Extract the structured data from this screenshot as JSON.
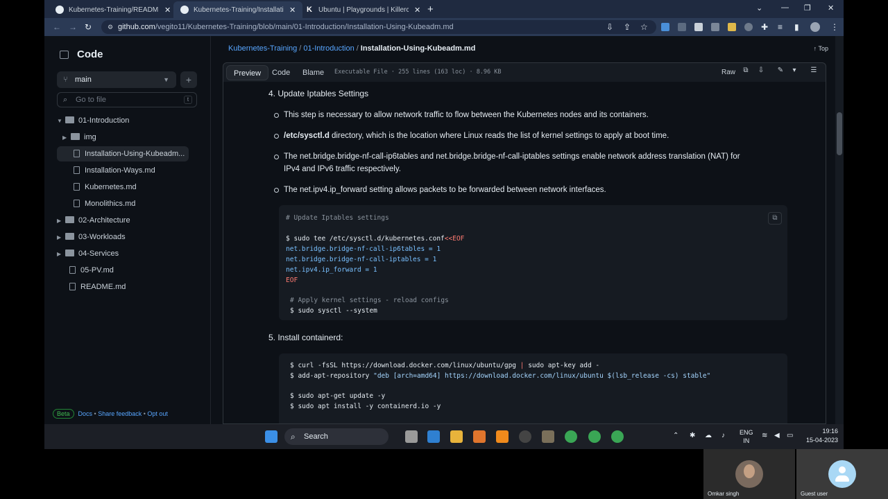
{
  "browser": {
    "tabs": [
      {
        "title": "Kubernetes-Training/README.m",
        "active": false
      },
      {
        "title": "Kubernetes-Training/Installation",
        "active": true
      },
      {
        "title": "Ubuntu | Playgrounds | Killercod",
        "active": false
      }
    ],
    "url_host": "github.com",
    "url_path": "/vegito11/Kubernetes-Training/blob/main/01-Introduction/Installation-Using-Kubeadm.md"
  },
  "sidebar": {
    "title": "Code",
    "branch": "main",
    "search_placeholder": "Go to file",
    "search_key": "t",
    "tree": [
      {
        "label": "01-Introduction",
        "type": "folder",
        "depth": 0,
        "expanded": true
      },
      {
        "label": "img",
        "type": "folder",
        "depth": 1,
        "expanded": false
      },
      {
        "label": "Installation-Using-Kubeadm...",
        "type": "file",
        "depth": 1,
        "selected": true
      },
      {
        "label": "Installation-Ways.md",
        "type": "file",
        "depth": 1
      },
      {
        "label": "Kubernetes.md",
        "type": "file",
        "depth": 1
      },
      {
        "label": "Monolithics.md",
        "type": "file",
        "depth": 1
      },
      {
        "label": "02-Architecture",
        "type": "folder",
        "depth": 0,
        "expanded": false
      },
      {
        "label": "03-Workloads",
        "type": "folder",
        "depth": 0,
        "expanded": false
      },
      {
        "label": "04-Services",
        "type": "folder",
        "depth": 0,
        "expanded": false
      },
      {
        "label": "05-PV.md",
        "type": "file",
        "depth": 0
      },
      {
        "label": "README.md",
        "type": "file",
        "depth": 0
      }
    ],
    "footer": {
      "beta": "Beta",
      "docs": "Docs",
      "feedback": "Share feedback",
      "optout": "Opt out"
    }
  },
  "breadcrumb": {
    "repo": "Kubernetes-Training",
    "folder": "01-Introduction",
    "file": "Installation-Using-Kubeadm.md"
  },
  "top_link": "Top",
  "file_tabs": {
    "preview": "Preview",
    "code": "Code",
    "blame": "Blame"
  },
  "file_info": "Executable File · 255 lines (163 loc) · 8.96 KB",
  "raw_label": "Raw",
  "content": {
    "step4": "4. Update Iptables Settings",
    "bullets": [
      "This step is necessary to allow network traffic to flow between the Kubernetes nodes and its containers.",
      " directory, which is the location where Linux reads the list of kernel settings to apply at boot time.",
      "The net.bridge.bridge-nf-call-ip6tables and net.bridge.bridge-nf-call-iptables settings enable network address translation (NAT) for",
      "IPv4 and IPv6 traffic respectively.",
      "The net.ipv4.ip_forward setting allows packets to be forwarded between network interfaces."
    ],
    "bullet2_bold": "/etc/sysctl.d",
    "code1": {
      "comment1": "# Update Iptables settings",
      "cmd1": "$ sudo tee /etc/sysctl.d/kubernetes.conf",
      "heredoc": "<<EOF",
      "line1": "net.bridge.bridge-nf-call-ip6tables = 1",
      "line2": "net.bridge.bridge-nf-call-iptables = 1",
      "line3": "net.ipv4.ip_forward = 1",
      "eof": "EOF",
      "comment2": "# Apply kernel settings - reload configs",
      "cmd2": "$ sudo sysctl --system"
    },
    "step5": "5. Install containerd:",
    "code2": {
      "l1a": "$ curl -fsSL https://download.docker.com/linux/ubuntu/gpg ",
      "l1pipe": "|",
      "l1b": " sudo apt-key add -",
      "l2a": "$ add-apt-repository ",
      "l2b": "\"deb [arch=amd64] https://download.docker.com/linux/ubuntu $(lsb_release -cs) stable\"",
      "l3": "$ sudo apt-get update -y",
      "l4": "$ sudo apt install -y containerd.io -y"
    }
  },
  "taskbar": {
    "search": "Search",
    "lang_top": "ENG",
    "lang_bottom": "IN",
    "time": "19:16",
    "date": "15-04-2023"
  },
  "video": {
    "participant1": "Omkar singh",
    "participant2": "Guest user"
  },
  "colors": {
    "link": "#58a6ff",
    "bg": "#0d1117",
    "code_bg": "#161b22",
    "heredoc": "#ff7b72"
  }
}
